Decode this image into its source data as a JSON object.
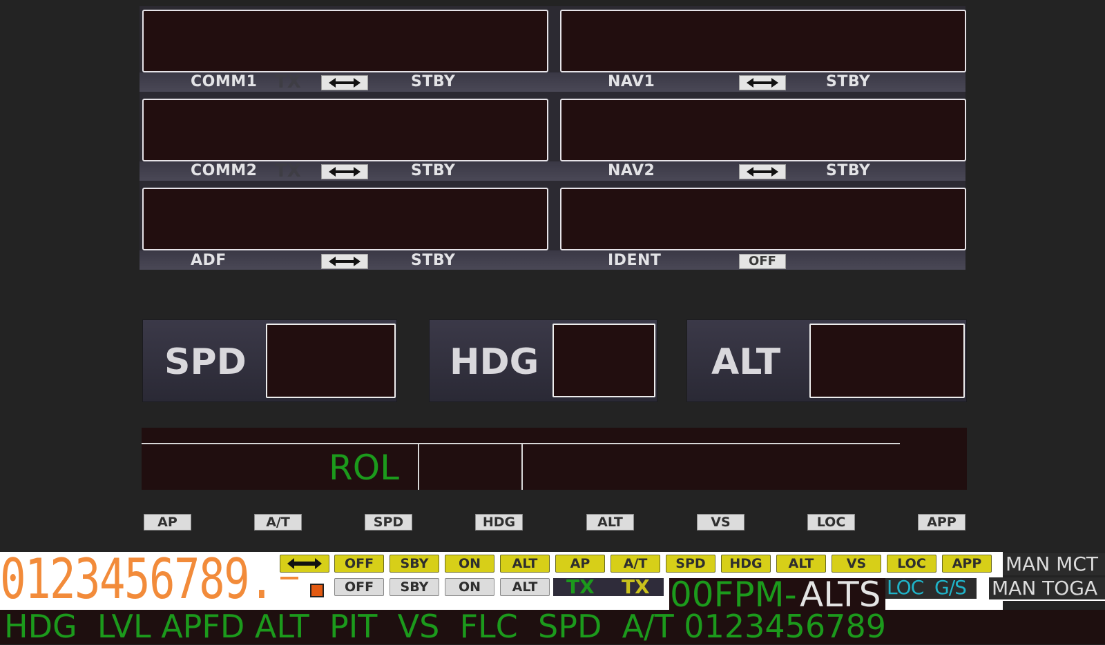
{
  "radios": {
    "comm1": {
      "label": "COMM1",
      "tx": "TX",
      "stby": "STBY"
    },
    "nav1": {
      "label": "NAV1",
      "stby": "STBY"
    },
    "comm2": {
      "label": "COMM2",
      "tx": "TX",
      "stby": "STBY"
    },
    "nav2": {
      "label": "NAV2",
      "stby": "STBY"
    },
    "adf": {
      "label": "ADF",
      "stby": "STBY"
    },
    "ident": {
      "label": "IDENT",
      "button": "OFF"
    }
  },
  "autopilot": {
    "spd": "SPD",
    "hdg": "HDG",
    "alt": "ALT"
  },
  "fma": {
    "lateral_mode": "ROL"
  },
  "annunciators": [
    "AP",
    "A/T",
    "SPD",
    "HDG",
    "ALT",
    "VS",
    "LOC",
    "APP"
  ],
  "sprites": {
    "digits": "0123456789.",
    "row1_buttons": [
      "OFF",
      "SBY",
      "ON",
      "ALT",
      "AP",
      "A/T",
      "SPD",
      "HDG",
      "ALT",
      "VS",
      "LOC",
      "APP"
    ],
    "row2_buttons": [
      "OFF",
      "SBY",
      "ON",
      "ALT"
    ],
    "tx_green": "TX",
    "tx_yellow": "TX",
    "man_mct": "MAN MCT",
    "man_toga": "MAN TOGA",
    "fpm_text": "00FPM-",
    "alts_text": "ALTS",
    "loc_text": "LOC",
    "gs_text": "G/S",
    "mode_strip": "HDG  LVL APFD ALT  PIT  VS  FLC  SPD  A/T 0123456789"
  },
  "colors": {
    "lcd": "#220e0f",
    "fma_green": "#1c9a1c",
    "sprite_orange": "#f28b3a",
    "button_yellow": "#d7cf18",
    "cyan": "#1fb3c8"
  }
}
